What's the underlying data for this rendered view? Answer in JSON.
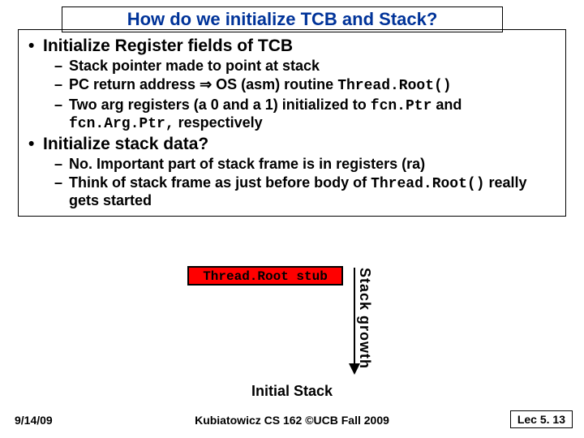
{
  "title": "How do we initialize TCB and Stack?",
  "b1a": "Initialize Register fields of TCB",
  "b1a_sub": {
    "s1": "Stack pointer made to point at stack",
    "s2a": "PC return address ",
    "s2arrow": "⇒",
    "s2b": " OS (asm) routine ",
    "s2mono": "Thread.Root()",
    "s3a": "Two arg registers (a 0 and a 1) initialized to ",
    "s3mono1": "fcn.Ptr",
    "s3b": " and ",
    "s3mono2": "fcn.Arg.Ptr,",
    "s3c": " respectively"
  },
  "b1b": "Initialize stack data?",
  "b1b_sub": {
    "s1": "No. Important part of stack frame is in registers (ra)",
    "s2a": "Think of stack frame as just before body of ",
    "s2mono": "Thread.Root()",
    "s2b": " really gets started"
  },
  "diagram": {
    "stub": "Thread.Root stub",
    "vlabel": "Stack growth",
    "caption": "Initial Stack"
  },
  "footer": {
    "left": "9/14/09",
    "center": "Kubiatowicz CS 162 ©UCB Fall 2009",
    "right": "Lec 5. 13"
  }
}
